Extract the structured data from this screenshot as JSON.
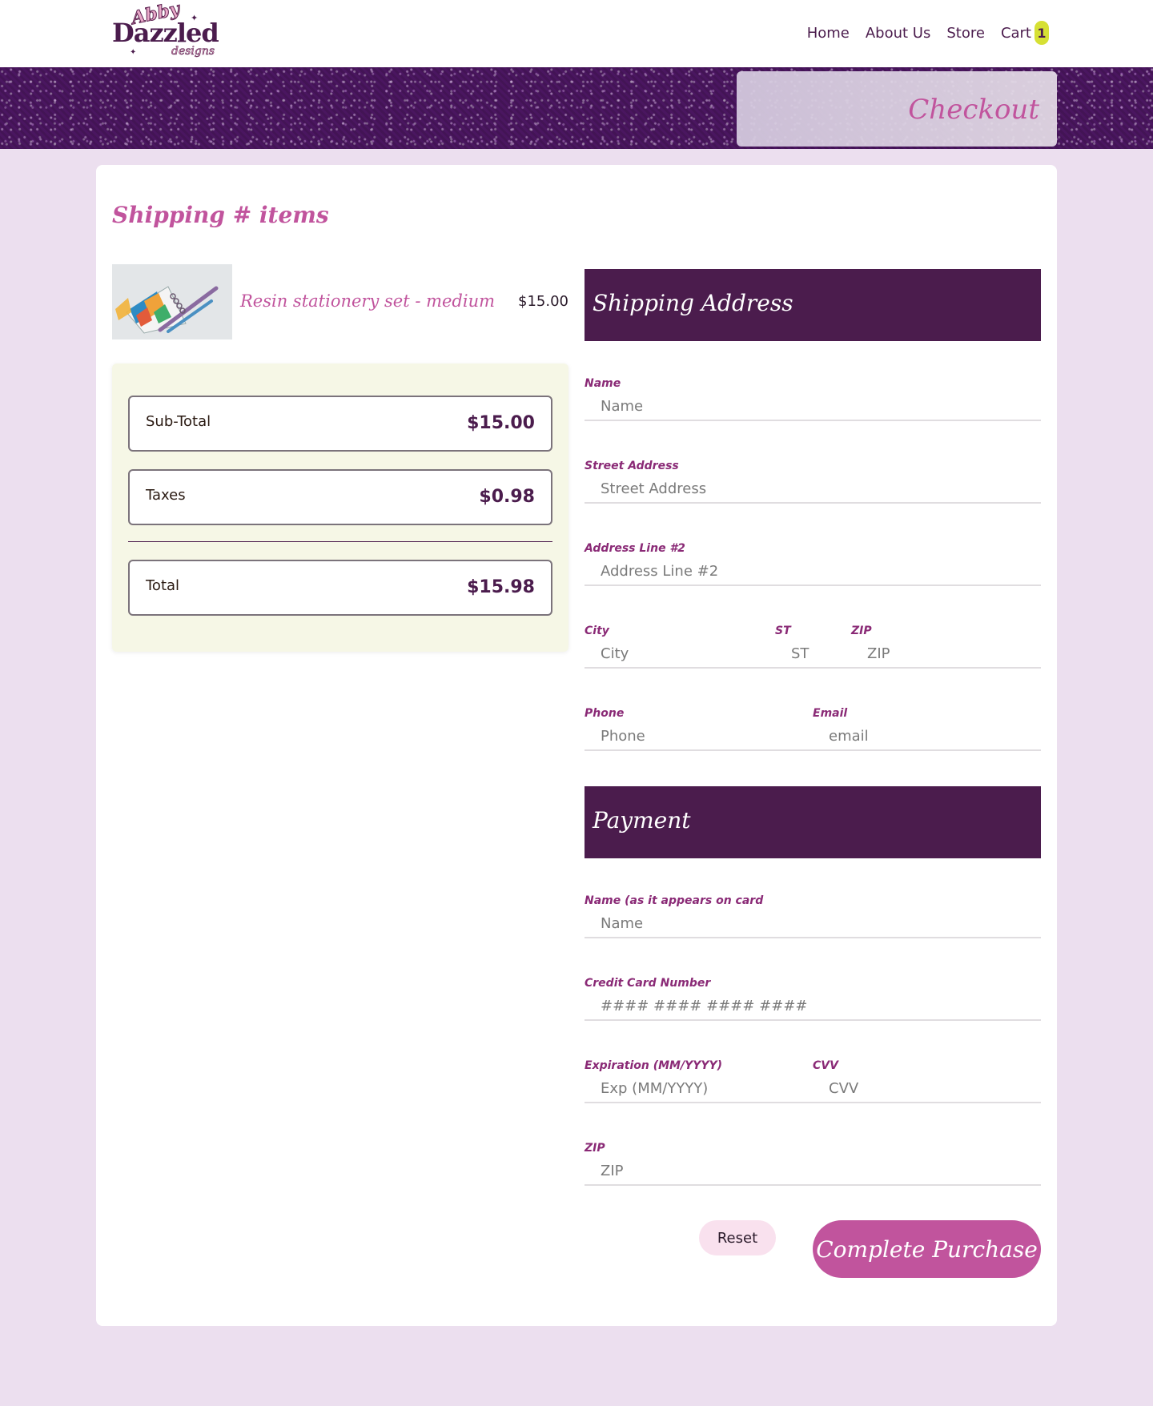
{
  "brand": {
    "logo_top": "Abby",
    "logo_main": "Dazzled",
    "logo_sub": "designs"
  },
  "nav": {
    "home": "Home",
    "about": "About Us",
    "store": "Store",
    "cart": "Cart",
    "cart_count": "1"
  },
  "hero": {
    "title": "Checkout"
  },
  "cart": {
    "section_title": "Shipping # items",
    "item": {
      "name": "Resin stationery set - medium",
      "price": "$15.00"
    }
  },
  "summary": {
    "subtotal_label": "Sub-Total",
    "subtotal_value": "$15.00",
    "taxes_label": "Taxes",
    "taxes_value": "$0.98",
    "total_label": "Total",
    "total_value": "$15.98"
  },
  "shipping": {
    "heading": "Shipping Address",
    "name_label": "Name",
    "name_placeholder": "Name",
    "street_label": "Street Address",
    "street_placeholder": "Street Address",
    "line2_label": "Address Line #2",
    "line2_placeholder": "Address Line #2",
    "city_label": "City",
    "city_placeholder": "City",
    "st_label": "ST",
    "st_placeholder": "ST",
    "zip_label": "ZIP",
    "zip_placeholder": "ZIP",
    "phone_label": "Phone",
    "phone_placeholder": "Phone",
    "email_label": "Email",
    "email_placeholder": "email"
  },
  "payment": {
    "heading": "Payment",
    "card_name_label": "Name (as it appears on card",
    "card_name_placeholder": "Name",
    "card_number_label": "Credit Card Number",
    "card_number_placeholder": "#### #### #### ####",
    "exp_label": "Expiration (MM/YYYY)",
    "exp_placeholder": "Exp (MM/YYYY)",
    "cvv_label": "CVV",
    "cvv_placeholder": "CVV",
    "zip_label": "ZIP",
    "zip_placeholder": "ZIP"
  },
  "actions": {
    "reset": "Reset",
    "complete": "Complete Purchase"
  },
  "colors": {
    "brand_purple": "#4b1c4d",
    "accent_pink": "#c1549d",
    "badge_yellow": "#d6e034",
    "page_bg": "#ecdfef",
    "summary_bg": "#f6f7e6"
  }
}
